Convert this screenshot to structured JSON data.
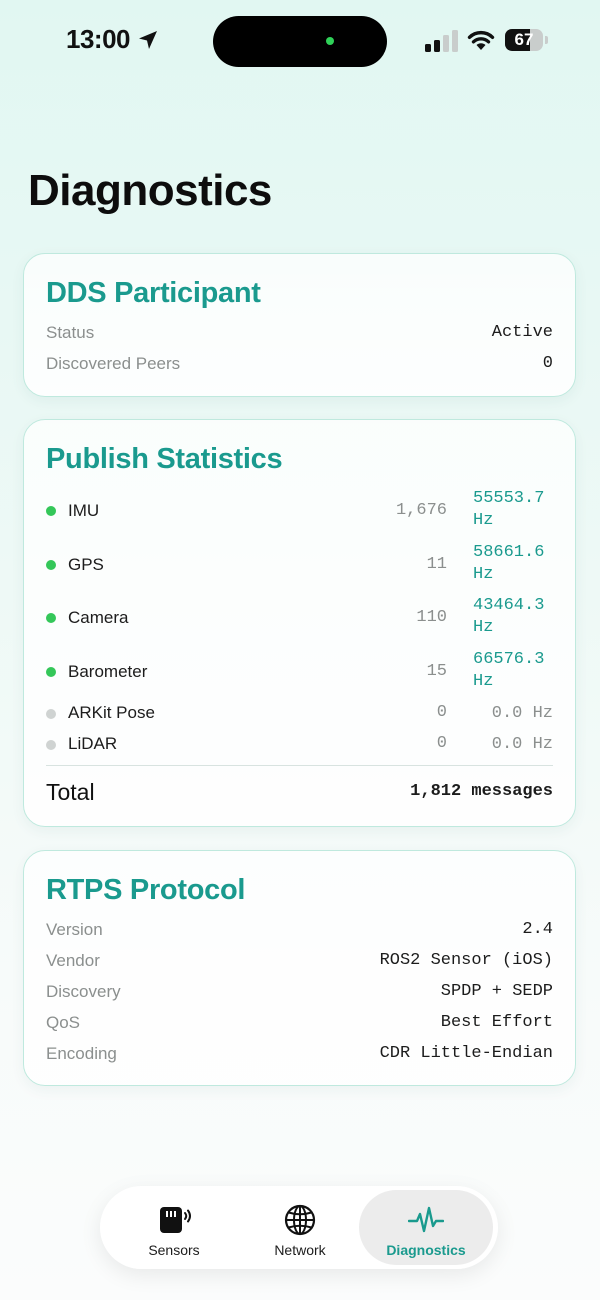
{
  "status_bar": {
    "time": "13:00",
    "battery_level": "67",
    "battery_fraction": 0.67,
    "icons": [
      "location-arrow-icon",
      "cellular-signal-icon",
      "wifi-icon",
      "battery-icon"
    ]
  },
  "page": {
    "title": "Diagnostics"
  },
  "dds": {
    "title": "DDS Participant",
    "rows": [
      {
        "label": "Status",
        "value": "Active"
      },
      {
        "label": "Discovered Peers",
        "value": "0"
      }
    ]
  },
  "publish": {
    "title": "Publish Statistics",
    "rows": [
      {
        "name": "IMU",
        "count": "1,676",
        "rate": "55553.7 Hz",
        "active": true
      },
      {
        "name": "GPS",
        "count": "11",
        "rate": "58661.6 Hz",
        "active": true
      },
      {
        "name": "Camera",
        "count": "110",
        "rate": "43464.3 Hz",
        "active": true
      },
      {
        "name": "Barometer",
        "count": "15",
        "rate": "66576.3 Hz",
        "active": true
      },
      {
        "name": "ARKit Pose",
        "count": "0",
        "rate": "0.0 Hz",
        "active": false
      },
      {
        "name": "LiDAR",
        "count": "0",
        "rate": "0.0 Hz",
        "active": false
      }
    ],
    "total_label": "Total",
    "total_value": "1,812 messages"
  },
  "rtps": {
    "title": "RTPS Protocol",
    "rows": [
      {
        "label": "Version",
        "value": "2.4"
      },
      {
        "label": "Vendor",
        "value": "ROS2 Sensor (iOS)"
      },
      {
        "label": "Discovery",
        "value": "SPDP + SEDP"
      },
      {
        "label": "QoS",
        "value": "Best Effort"
      },
      {
        "label": "Encoding",
        "value": "CDR Little-Endian"
      }
    ]
  },
  "tabs": [
    {
      "label": "Sensors",
      "icon": "sensor-icon",
      "active": false
    },
    {
      "label": "Network",
      "icon": "globe-icon",
      "active": false
    },
    {
      "label": "Diagnostics",
      "icon": "waveform-icon",
      "active": true
    }
  ],
  "colors": {
    "accent": "#1a9a8e",
    "active_dot": "#34c759",
    "inactive_dot": "#cfd3d2",
    "island_indicator": "#2fd158"
  }
}
